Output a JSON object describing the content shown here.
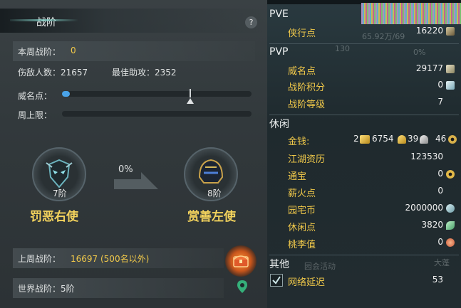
{
  "panel": {
    "title": "战阶",
    "help": "?",
    "week_rank_label": "本周战阶：",
    "week_rank_value": "0",
    "defeated_label": "伤敌人数：21657",
    "best_assist_label": "最佳助攻：2352",
    "prestige_label": "威名点：",
    "prestige_fill": 0.04,
    "weekly_cap_label": "周上限：",
    "progress_percent": "0%",
    "current_rank": {
      "level": "7阶",
      "name": "罚恶右使"
    },
    "next_rank": {
      "level": "8阶",
      "name": "赏善左使"
    },
    "last_week_label": "上周战阶：",
    "last_week_value": "16697 (500名以外)",
    "world_rank_label": "世界战阶：5阶"
  },
  "stats": {
    "pve": {
      "heading": "PVE",
      "rows": [
        {
          "label": "侠行点",
          "value": "16220",
          "icon": "brush-icon"
        }
      ],
      "faded_text": "65.92万/69"
    },
    "pvp": {
      "heading": "PVP",
      "faded_left": "130",
      "faded_pct": "0%",
      "rows": [
        {
          "label": "威名点",
          "value": "29177",
          "icon": "prestige-icon"
        },
        {
          "label": "战阶积分",
          "value": "0",
          "icon": "crystal-icon"
        },
        {
          "label": "战阶等级",
          "value": "7"
        }
      ]
    },
    "leisure": {
      "heading": "休闲",
      "money": {
        "label": "金钱:",
        "gold_bars": "2",
        "gold": "6754",
        "silver": "39",
        "copper": "46"
      },
      "rows": [
        {
          "label": "江湖资历",
          "value": "123530"
        },
        {
          "label": "通宝",
          "value": "0",
          "icon": "coin-icon"
        },
        {
          "label": "薪火点",
          "value": "0"
        },
        {
          "label": "园宅币",
          "value": "2000000",
          "icon": "swirl-icon"
        },
        {
          "label": "休闲点",
          "value": "3820",
          "icon": "leaf-icon"
        },
        {
          "label": "桃李值",
          "value": "0",
          "icon": "peach-icon"
        }
      ]
    },
    "other": {
      "heading": "其他",
      "latency_label": "网络延迟",
      "latency_value": "53",
      "faded_right": "大蓬",
      "faded_mid": "园会活动"
    }
  },
  "colors": {
    "accent_yellow": "#f1c94a",
    "slider_blue": "#4aa3e8",
    "rank_gold": "#f3d35d"
  }
}
